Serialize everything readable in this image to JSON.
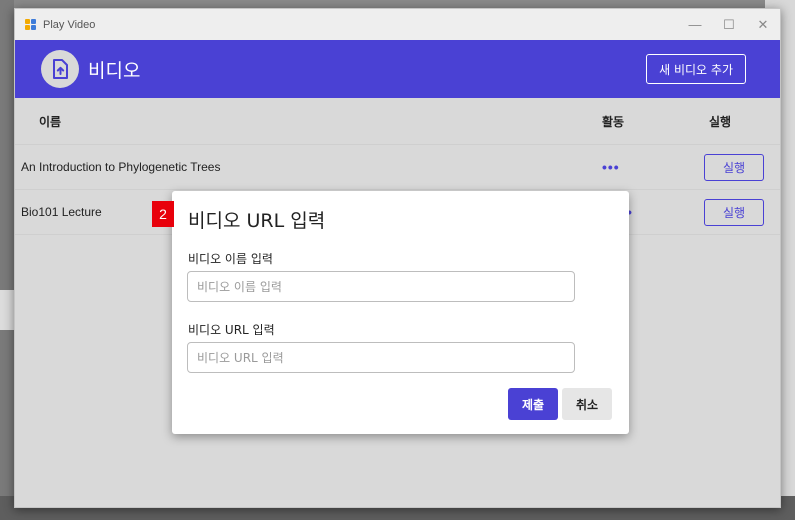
{
  "window": {
    "title": "Play Video",
    "minimize_glyph": "—",
    "maximize_glyph": "☐",
    "close_glyph": "✕"
  },
  "header": {
    "icon": "upload-file-icon",
    "title": "비디오",
    "add_button_label": "새 비디오 추가",
    "accent_color": "#4a41d4"
  },
  "table": {
    "columns": [
      "이름",
      "활동",
      "실행"
    ],
    "rows": [
      {
        "name": "An Introduction to Phylogenetic Trees",
        "activity": "•••",
        "run_label": "실행"
      },
      {
        "name": "Bio101 Lecture",
        "activity": "•",
        "run_label": "실행"
      }
    ]
  },
  "dialog": {
    "badge": "2",
    "title": "비디오 URL 입력",
    "name_label": "비디오 이름 입력",
    "name_placeholder": "비디오 이름 입력",
    "name_value": "",
    "url_label": "비디오 URL 입력",
    "url_placeholder": "비디오 URL 입력",
    "url_value": "",
    "submit_label": "제출",
    "cancel_label": "취소"
  }
}
